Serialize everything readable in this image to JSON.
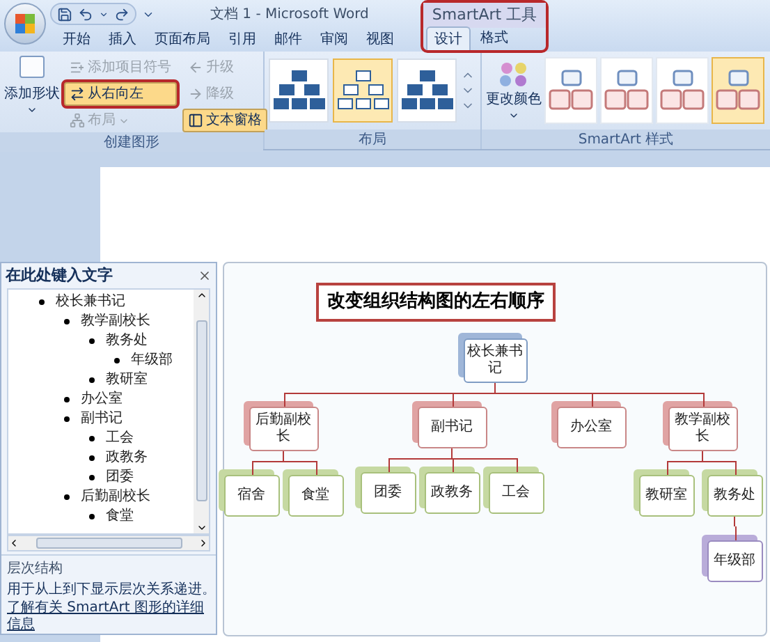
{
  "window": {
    "title": "文档 1 - Microsoft Word",
    "context_tools": "SmartArt 工具"
  },
  "tabs": [
    {
      "label": "开始",
      "selected": false
    },
    {
      "label": "插入",
      "selected": false
    },
    {
      "label": "页面布局",
      "selected": false
    },
    {
      "label": "引用",
      "selected": false
    },
    {
      "label": "邮件",
      "selected": false
    },
    {
      "label": "审阅",
      "selected": false
    },
    {
      "label": "视图",
      "selected": false
    }
  ],
  "context_tabs": [
    {
      "label": "设计",
      "selected": true
    },
    {
      "label": "格式",
      "selected": false
    }
  ],
  "ribbon": {
    "create": {
      "label": "创建图形",
      "add_shape": "添加形状",
      "buttons": [
        {
          "label": "添加项目符号",
          "kind": "bullet",
          "disabled": true,
          "selected": false
        },
        {
          "label": "从右向左",
          "kind": "rtl",
          "disabled": false,
          "selected": true
        },
        {
          "label": "布局",
          "kind": "layout",
          "disabled": true,
          "selected": false
        }
      ],
      "buttons_2": [
        {
          "label": "升级",
          "kind": "promote",
          "disabled": true,
          "selected": false
        },
        {
          "label": "降级",
          "kind": "demote",
          "disabled": true,
          "selected": false
        },
        {
          "label": "文本窗格",
          "kind": "pane",
          "disabled": false,
          "selected": true
        }
      ]
    },
    "layouts": {
      "label": "布局",
      "thumbnails": [
        {
          "selected": false
        },
        {
          "selected": true
        },
        {
          "selected": false
        }
      ]
    },
    "styles": {
      "label": "SmartArt 样式",
      "change_colors": "更改颜色",
      "thumbnails": [
        {
          "selected": false
        },
        {
          "selected": false
        },
        {
          "selected": false
        },
        {
          "selected": true
        }
      ]
    }
  },
  "text_pane": {
    "title": "在此处键入文字",
    "items": [
      {
        "label": "校长兼书记",
        "children": [
          {
            "label": "教学副校长",
            "children": [
              {
                "label": "教务处",
                "children": [
                  {
                    "label": "年级部"
                  }
                ]
              },
              {
                "label": "教研室"
              }
            ]
          },
          {
            "label": "办公室"
          },
          {
            "label": "副书记",
            "children": [
              {
                "label": "工会"
              },
              {
                "label": "政教务"
              },
              {
                "label": "团委"
              }
            ]
          },
          {
            "label": "后勤副校长",
            "children": [
              {
                "label": "食堂"
              }
            ]
          }
        ]
      }
    ],
    "footer_title": "层次结构",
    "description": "用于从上到下显示层次关系递进。",
    "link": "了解有关 SmartArt 图形的详细信息"
  },
  "chart": {
    "title": "改变组织结构图的左右顺序",
    "nodes": [
      {
        "label": "校长兼书记",
        "children": [
          {
            "label": "后勤副校长",
            "children": [
              {
                "label": "宿舍"
              },
              {
                "label": "食堂"
              }
            ]
          },
          {
            "label": "副书记",
            "children": [
              {
                "label": "团委"
              },
              {
                "label": "政教务"
              },
              {
                "label": "工会"
              }
            ]
          },
          {
            "label": "办公室"
          },
          {
            "label": "教学副校长",
            "children": [
              {
                "label": "教研室"
              },
              {
                "label": "教务处",
                "children": [
                  {
                    "label": "年级部"
                  }
                ]
              }
            ]
          }
        ]
      }
    ]
  }
}
